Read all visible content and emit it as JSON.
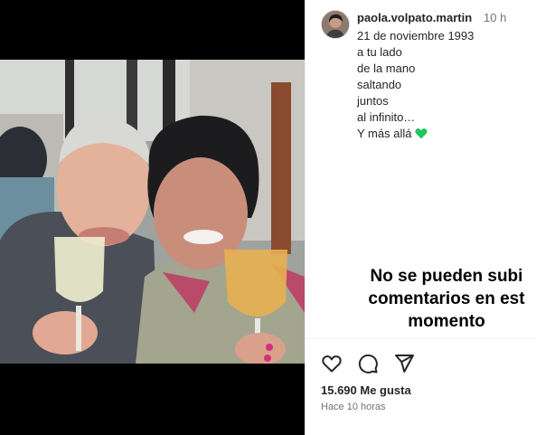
{
  "post": {
    "username": "paola.volpato.martin",
    "time_ago": "10 h",
    "caption_lines": [
      "21 de noviembre 1993",
      "a tu lado",
      "de la mano",
      "saltando",
      "juntos",
      "al infinito…",
      "Y más allá"
    ],
    "caption_emoji": "green-heart-icon",
    "comments_disabled_message": "No se pueden subir comentarios en este momento",
    "comments_disabled_lines": [
      "No se pueden subi",
      "comentarios en est",
      "momento"
    ],
    "likes": "15.690 Me gusta",
    "posted_ago": "Hace 10 horas"
  },
  "colors": {
    "heart": "#22c55e",
    "text": "#262626",
    "muted": "#737373"
  }
}
